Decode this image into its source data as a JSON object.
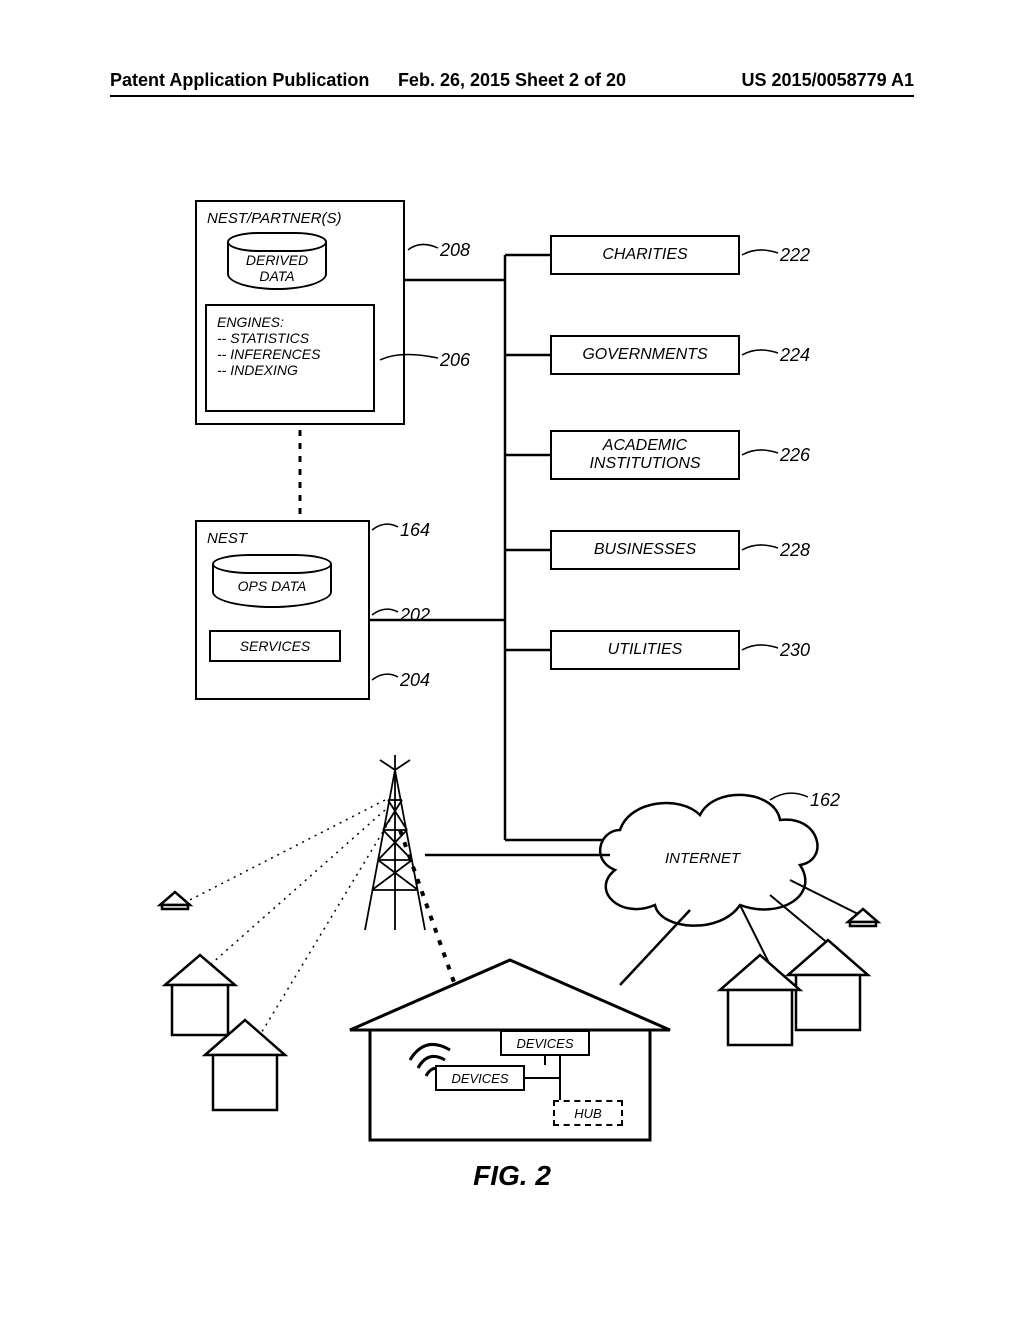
{
  "header": {
    "left": "Patent Application Publication",
    "center": "Feb. 26, 2015  Sheet 2 of 20",
    "right": "US 2015/0058779 A1"
  },
  "nestpartners": {
    "title": "NEST/PARTNER(S)",
    "derived_data": "DERIVED\nDATA",
    "engines_title": "ENGINES:",
    "engines_l1": "-- STATISTICS",
    "engines_l2": "-- INFERENCES",
    "engines_l3": "-- INDEXING"
  },
  "nest": {
    "title": "NEST",
    "ops_data": "OPS DATA",
    "services": "SERVICES"
  },
  "entities": {
    "charities": "CHARITIES",
    "governments": "GOVERNMENTS",
    "academic": "ACADEMIC\nINSTITUTIONS",
    "businesses": "BUSINESSES",
    "utilities": "UTILITIES"
  },
  "cloud": "INTERNET",
  "house": {
    "devices1": "DEVICES",
    "devices2": "DEVICES",
    "hub": "HUB"
  },
  "refs": {
    "r208": "208",
    "r206": "206",
    "r164": "164",
    "r202": "202",
    "r204": "204",
    "r222": "222",
    "r224": "224",
    "r226": "226",
    "r228": "228",
    "r230": "230",
    "r162": "162"
  },
  "figure": "FIG. 2"
}
